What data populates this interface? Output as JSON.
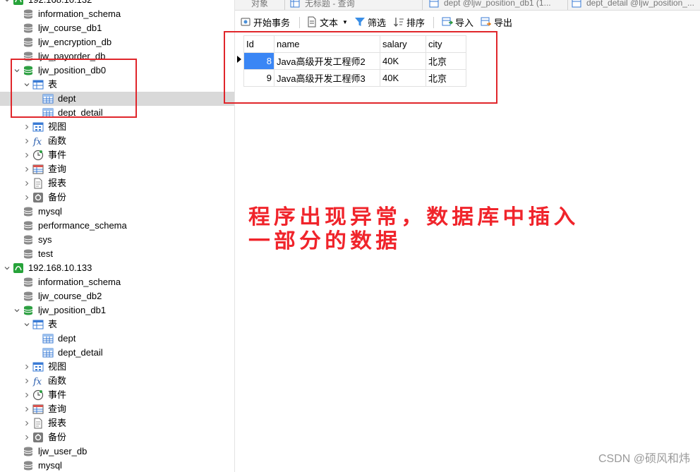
{
  "sidebar": {
    "rows": [
      {
        "label": "192.168.10.132",
        "type": "server",
        "twisty": "open"
      },
      {
        "label": "information_schema",
        "type": "db",
        "twisty": ""
      },
      {
        "label": "ljw_course_db1",
        "type": "db",
        "twisty": ""
      },
      {
        "label": "ljw_encryption_db",
        "type": "db",
        "twisty": ""
      },
      {
        "label": "ljw_payorder_db",
        "type": "db",
        "twisty": ""
      },
      {
        "label": "ljw_position_db0",
        "type": "db-open",
        "twisty": "open"
      },
      {
        "label": "表",
        "type": "tables",
        "twisty": "open"
      },
      {
        "label": "dept",
        "type": "table",
        "twisty": ""
      },
      {
        "label": "dept_detail",
        "type": "table",
        "twisty": ""
      },
      {
        "label": "视图",
        "type": "view",
        "twisty": "closed"
      },
      {
        "label": "函数",
        "type": "func",
        "twisty": "closed"
      },
      {
        "label": "事件",
        "type": "event",
        "twisty": "closed"
      },
      {
        "label": "查询",
        "type": "query",
        "twisty": "closed"
      },
      {
        "label": "报表",
        "type": "report",
        "twisty": "closed"
      },
      {
        "label": "备份",
        "type": "backup",
        "twisty": "closed"
      },
      {
        "label": "mysql",
        "type": "db",
        "twisty": ""
      },
      {
        "label": "performance_schema",
        "type": "db",
        "twisty": ""
      },
      {
        "label": "sys",
        "type": "db",
        "twisty": ""
      },
      {
        "label": "test",
        "type": "db",
        "twisty": ""
      },
      {
        "label": "192.168.10.133",
        "type": "server",
        "twisty": "open"
      },
      {
        "label": "information_schema",
        "type": "db",
        "twisty": ""
      },
      {
        "label": "ljw_course_db2",
        "type": "db",
        "twisty": ""
      },
      {
        "label": "ljw_position_db1",
        "type": "db-open",
        "twisty": "open"
      },
      {
        "label": "表",
        "type": "tables",
        "twisty": "open"
      },
      {
        "label": "dept",
        "type": "table",
        "twisty": ""
      },
      {
        "label": "dept_detail",
        "type": "table",
        "twisty": ""
      },
      {
        "label": "视图",
        "type": "view",
        "twisty": "closed"
      },
      {
        "label": "函数",
        "type": "func",
        "twisty": "closed"
      },
      {
        "label": "事件",
        "type": "event",
        "twisty": "closed"
      },
      {
        "label": "查询",
        "type": "query",
        "twisty": "closed"
      },
      {
        "label": "报表",
        "type": "report",
        "twisty": "closed"
      },
      {
        "label": "备份",
        "type": "backup",
        "twisty": "closed"
      },
      {
        "label": "ljw_user_db",
        "type": "db",
        "twisty": ""
      },
      {
        "label": "mysql",
        "type": "db",
        "twisty": ""
      }
    ]
  },
  "tabs": {
    "objects": "对象",
    "untitled_query": "无标题 - 查询",
    "dept_tab": "dept @ljw_position_db1 (1...",
    "dept_detail_tab": "dept_detail @ljw_position_..."
  },
  "toolbar": {
    "begin_transaction": "开始事务",
    "text": "文本",
    "filter": "筛选",
    "sort": "排序",
    "import": "导入",
    "export": "导出"
  },
  "grid": {
    "columns": [
      "Id",
      "name",
      "salary",
      "city"
    ],
    "rows": [
      [
        "8",
        "Java高级开发工程师2",
        "40K",
        "北京"
      ],
      [
        "9",
        "Java高级开发工程师3",
        "40K",
        "北京"
      ]
    ]
  },
  "annotation": {
    "line1": "程序出现异常，数据库中插入",
    "line2": "一部分的数据"
  },
  "watermark": "CSDN @硕风和炜",
  "colors": {
    "highlight_box": "#e0262b",
    "annotation_text": "#f0242b",
    "selected_cell": "#3a86f5",
    "selected_row": "#d9d9d9"
  }
}
